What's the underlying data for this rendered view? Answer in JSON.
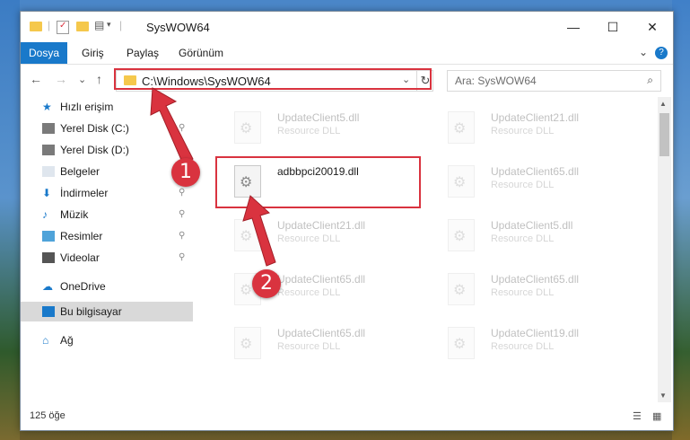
{
  "window": {
    "title": "SysWOW64",
    "controls": {
      "minimize": "—",
      "maximize": "☐",
      "close": "✕"
    }
  },
  "ribbon": {
    "tabs": [
      "Dosya",
      "Giriş",
      "Paylaş",
      "Görünüm"
    ],
    "help": "?",
    "expand": "⌄"
  },
  "nav": {
    "back": "←",
    "forward": "→",
    "recent": "⌄",
    "up": "↑",
    "address": "C:\\Windows\\SysWOW64",
    "address_dropdown": "⌄",
    "refresh": "↻",
    "search_placeholder": "Ara: SysWOW64",
    "search_icon": "⌕"
  },
  "sidebar": {
    "items": [
      {
        "label": "Hızlı erişim",
        "icon": "star-icon",
        "color": "#1979ca",
        "pinned": false
      },
      {
        "label": "Yerel Disk (C:)",
        "icon": "drive-icon",
        "color": "#7a7a7a",
        "pinned": true
      },
      {
        "label": "Yerel Disk (D:)",
        "icon": "drive-icon",
        "color": "#7a7a7a",
        "pinned": true
      },
      {
        "label": "Belgeler",
        "icon": "documents-icon",
        "color": "#dfe6ee",
        "pinned": true
      },
      {
        "label": "İndirmeler",
        "icon": "download-icon",
        "color": "#1979ca",
        "pinned": true
      },
      {
        "label": "Müzik",
        "icon": "music-icon",
        "color": "#1979ca",
        "pinned": true
      },
      {
        "label": "Resimler",
        "icon": "pictures-icon",
        "color": "#4fa3d9",
        "pinned": true
      },
      {
        "label": "Videolar",
        "icon": "videos-icon",
        "color": "#555",
        "pinned": true
      },
      {
        "label": "OneDrive",
        "icon": "cloud-icon",
        "color": "#1979ca",
        "pinned": false
      },
      {
        "label": "Bu bilgisayar",
        "icon": "computer-icon",
        "color": "#1979ca",
        "pinned": false,
        "selected": true
      },
      {
        "label": "Ağ",
        "icon": "network-icon",
        "color": "#1979ca",
        "pinned": false
      }
    ],
    "pin_glyph": "📌"
  },
  "files": [
    {
      "name": "UpdateClient5.dll",
      "type": "Resource DLL",
      "faded": true
    },
    {
      "name": "UpdateClient21.dll",
      "type": "Resource DLL",
      "faded": true
    },
    {
      "name": "adbbpci20019.dll",
      "type": "",
      "faded": false
    },
    {
      "name": "UpdateClient65.dll",
      "type": "Resource DLL",
      "faded": true
    },
    {
      "name": "UpdateClient21.dll",
      "type": "Resource DLL",
      "faded": true
    },
    {
      "name": "UpdateClient5.dll",
      "type": "Resource DLL",
      "faded": true
    },
    {
      "name": "UpdateClient65.dll",
      "type": "Resource DLL",
      "faded": true
    },
    {
      "name": "UpdateClient65.dll",
      "type": "Resource DLL",
      "faded": true
    },
    {
      "name": "UpdateClient65.dll",
      "type": "Resource DLL",
      "faded": true
    },
    {
      "name": "UpdateClient19.dll",
      "type": "Resource DLL",
      "faded": true
    }
  ],
  "status": {
    "count": "125 öğe",
    "details_view": "☰",
    "icons_view": "▦"
  },
  "annotations": {
    "badge1": "1",
    "badge2": "2",
    "highlight_color": "#d9333f"
  }
}
